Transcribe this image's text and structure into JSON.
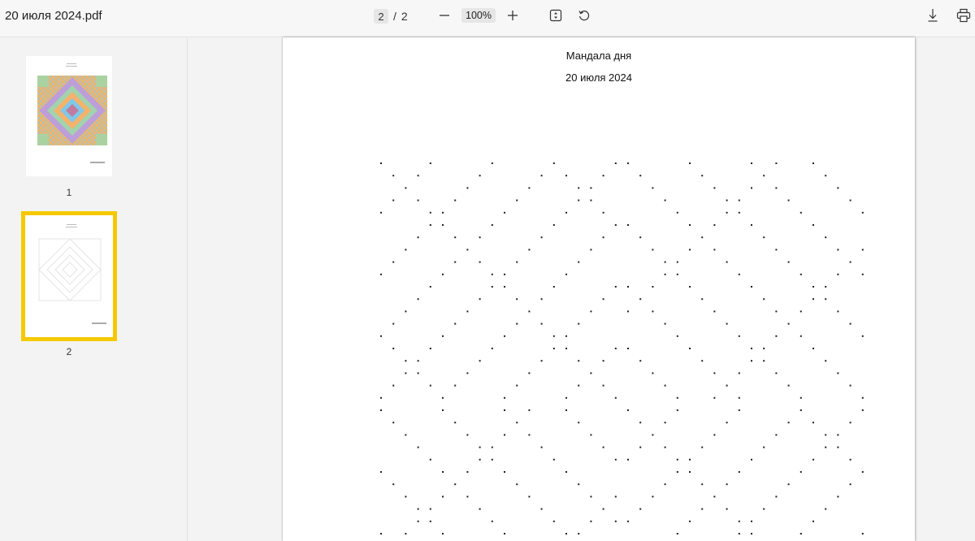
{
  "document": {
    "title": "20 июля 2024.pdf"
  },
  "toolbar": {
    "current_page": "2",
    "separator": "/",
    "total_pages": "2",
    "zoom": "100%",
    "icons": [
      "minus-icon",
      "plus-icon",
      "fit-page-icon",
      "rotate-icon",
      "download-icon",
      "print-icon"
    ]
  },
  "sidebar": {
    "thumbnails": [
      {
        "label": "1",
        "selected": false
      },
      {
        "label": "2",
        "selected": true
      }
    ],
    "selection_color": "#f5c900"
  },
  "page": {
    "heading": "Мандала дня",
    "date": "20 июля 2024"
  }
}
